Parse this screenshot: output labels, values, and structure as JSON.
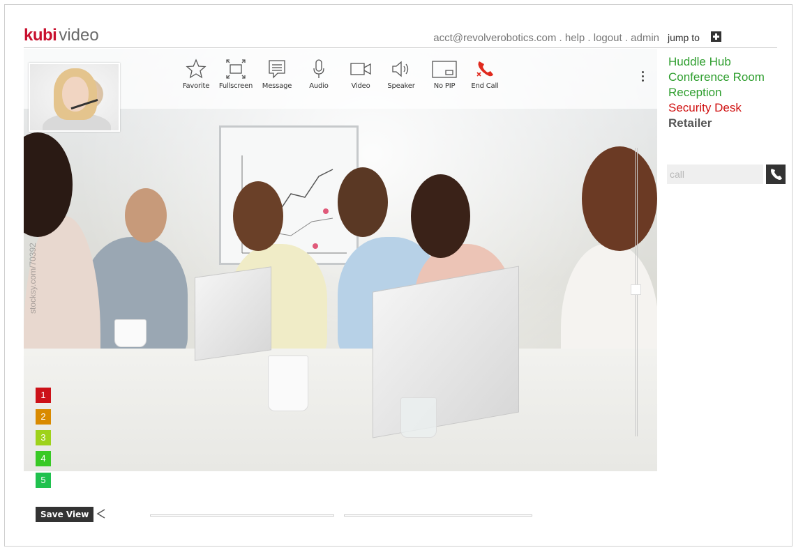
{
  "header": {
    "brand": "kubi",
    "brand_sub": "video",
    "account_links": [
      {
        "label": "acct@revolverobotics.com"
      },
      {
        "label": "help"
      },
      {
        "label": "logout"
      },
      {
        "label": "admin"
      }
    ],
    "separator": " . "
  },
  "toolbar": {
    "buttons": [
      {
        "label": "Favorite",
        "icon": "star-icon"
      },
      {
        "label": "Fullscreen",
        "icon": "fullscreen-icon"
      },
      {
        "label": "Message",
        "icon": "message-icon"
      },
      {
        "label": "Audio",
        "icon": "microphone-icon"
      },
      {
        "label": "Video",
        "icon": "video-camera-icon"
      },
      {
        "label": "Speaker",
        "icon": "speaker-icon"
      },
      {
        "label": "No PIP",
        "icon": "pip-icon"
      },
      {
        "label": "End Call",
        "icon": "end-call-icon"
      }
    ],
    "more_icon": "kebab-menu-icon"
  },
  "video": {
    "watermark": "stocksy.com/70392",
    "tilt_level": 0.49
  },
  "presets": [
    {
      "label": "1",
      "color": "#cc1118"
    },
    {
      "label": "2",
      "color": "#d98a00"
    },
    {
      "label": "3",
      "color": "#9ed21a"
    },
    {
      "label": "4",
      "color": "#38c925"
    },
    {
      "label": "5",
      "color": "#20c14e"
    }
  ],
  "bottom": {
    "save_view_label": "Save View",
    "share_icon": "share-icon"
  },
  "sidebar": {
    "jump_to_label": "jump to",
    "jump_icon": "plus-icon",
    "rooms": [
      {
        "label": "Huddle Hub",
        "color": "#2e9e2e",
        "bold": false
      },
      {
        "label": "Conference Room",
        "color": "#2e9e2e",
        "bold": false
      },
      {
        "label": "Reception",
        "color": "#2e9e2e",
        "bold": false
      },
      {
        "label": "Security Desk",
        "color": "#d01010",
        "bold": false
      },
      {
        "label": "Retailer",
        "color": "#555555",
        "bold": true
      }
    ],
    "call_placeholder": "call",
    "call_icon": "phone-icon"
  },
  "colors": {
    "brand_red": "#c8102e",
    "end_call_red": "#e02a1e"
  }
}
